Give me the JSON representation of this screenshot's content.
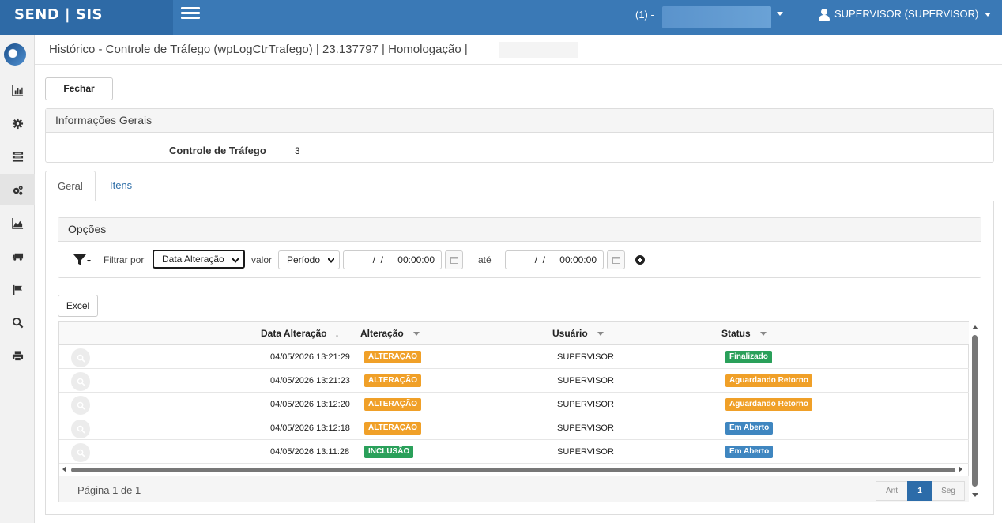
{
  "app": {
    "brand": "SEND | SIS"
  },
  "topbar": {
    "company_prefix": "(1) -",
    "user_label": "SUPERVISOR (SUPERVISOR)"
  },
  "page": {
    "title": "Histórico - Controle de Tráfego (wpLogCtrTrafego) | 23.137797 | Homologação |"
  },
  "actions": {
    "close_label": "Fechar",
    "excel_label": "Excel"
  },
  "info_panel": {
    "header": "Informações Gerais",
    "field_label": "Controle de Tráfego",
    "field_value": "3"
  },
  "tabs": [
    {
      "label": "Geral",
      "active": true
    },
    {
      "label": "Itens",
      "active": false
    }
  ],
  "options_panel": {
    "header": "Opções",
    "filter_by_label": "Filtrar por",
    "filter_field": "Data Alteração",
    "value_label": "valor",
    "value_mode": "Período",
    "date_from": "  /  /",
    "time_from": "00:00:00",
    "until_label": "até",
    "date_to": "  /  /",
    "time_to": "00:00:00"
  },
  "grid": {
    "columns": [
      "Data Alteração",
      "Alteração",
      "Usuário",
      "Status"
    ],
    "rows": [
      {
        "date": "04/05/2026 13:21:29",
        "change": "ALTERAÇÃO",
        "user": "SUPERVISOR",
        "status": "Finalizado"
      },
      {
        "date": "04/05/2026 13:21:23",
        "change": "ALTERAÇÃO",
        "user": "SUPERVISOR",
        "status": "Aguardando Retorno"
      },
      {
        "date": "04/05/2026 13:12:20",
        "change": "ALTERAÇÃO",
        "user": "SUPERVISOR",
        "status": "Aguardando Retorno"
      },
      {
        "date": "04/05/2026 13:12:18",
        "change": "ALTERAÇÃO",
        "user": "SUPERVISOR",
        "status": "Em Aberto"
      },
      {
        "date": "04/05/2026 13:11:28",
        "change": "INCLUSÃO",
        "user": "SUPERVISOR",
        "status": "Em Aberto"
      }
    ],
    "page_info": "Página 1 de 1",
    "pager": {
      "prev": "Ant",
      "current": "1",
      "next": "Seg"
    }
  },
  "colors": {
    "topbar": "#3a79b6",
    "brand_bg": "#2e6aa6",
    "badge_alteracao": "#f0a028",
    "badge_inclusao": "#2aa05a",
    "status_finalizado": "#2aa05a",
    "status_aguardando": "#f0a028",
    "status_aberto": "#3f86c0"
  },
  "sidebar": {
    "icons": [
      "chart-bar-icon",
      "gear-icon",
      "list-icon",
      "gears-icon",
      "area-chart-icon",
      "truck-icon",
      "flag-icon",
      "search-icon",
      "print-icon"
    ]
  }
}
